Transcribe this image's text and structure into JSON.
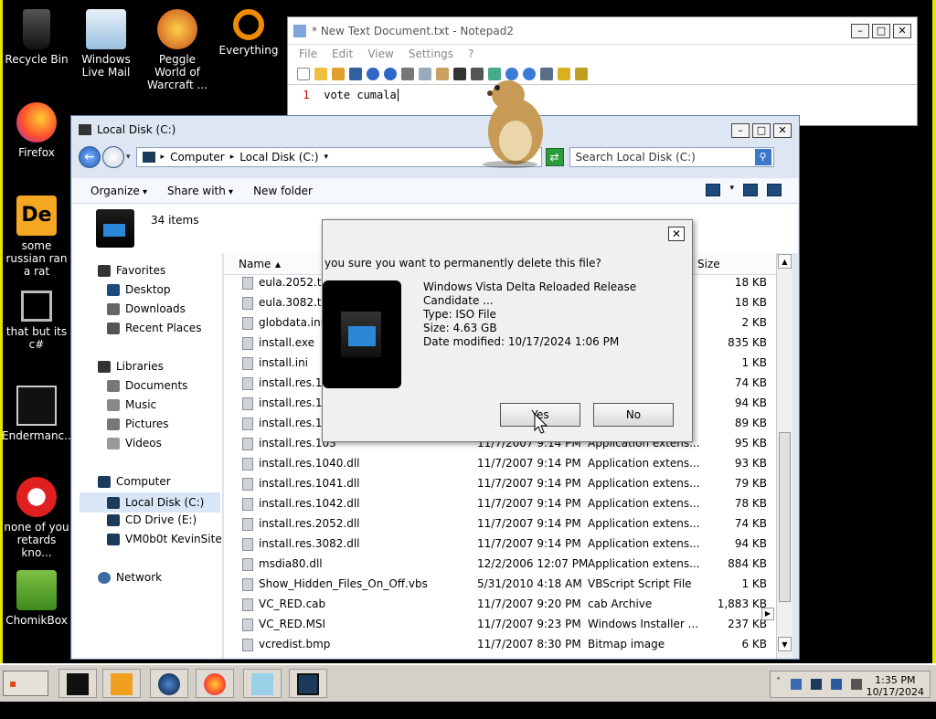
{
  "desktop": {
    "icons": [
      {
        "label": "Recycle Bin",
        "icon": "recycle-bin-icon"
      },
      {
        "label": "Windows Live Mail",
        "icon": "mail-icon"
      },
      {
        "label": "Peggle World of Warcraft ...",
        "icon": "peggle-icon"
      },
      {
        "label": "Everything",
        "icon": "magnifier-icon"
      },
      {
        "label": "Firefox",
        "icon": "firefox-icon"
      },
      {
        "label": "some russian ran a rat",
        "icon": "de-icon"
      },
      {
        "label": "that but its c#",
        "icon": "windows-stack-icon"
      },
      {
        "label": "Endermanc...",
        "icon": "terminal-icon"
      },
      {
        "label": "none of you retards kno...",
        "icon": "dragon-icon"
      },
      {
        "label": "ChomikBox",
        "icon": "hamster-box-icon"
      }
    ]
  },
  "notepad": {
    "title": "* New Text Document.txt - Notepad2",
    "menu": [
      "File",
      "Edit",
      "View",
      "Settings",
      "?"
    ],
    "line_number": "1",
    "content": "vote cumala"
  },
  "explorer": {
    "title": "Local Disk (C:)",
    "breadcrumb": [
      "Computer",
      "Local Disk (C:)"
    ],
    "search_placeholder": "Search Local Disk (C:)",
    "commands": {
      "organize": "Organize",
      "share": "Share with",
      "new_folder": "New folder"
    },
    "item_count": "34 items",
    "nav": {
      "favorites": "Favorites",
      "desktop": "Desktop",
      "downloads": "Downloads",
      "recent": "Recent Places",
      "libraries": "Libraries",
      "documents": "Documents",
      "music": "Music",
      "pictures": "Pictures",
      "videos": "Videos",
      "computer": "Computer",
      "local_disk": "Local Disk (C:)",
      "cd_drive": "CD Drive (E:)",
      "vm": "VM0b0t KevinSite",
      "network": "Network"
    },
    "columns": {
      "name": "Name",
      "size": "Size"
    },
    "files": [
      {
        "name": "eula.2052.txt",
        "date": "",
        "type": "",
        "size": "18 KB"
      },
      {
        "name": "eula.3082.txt",
        "date": "",
        "type": "",
        "size": "18 KB"
      },
      {
        "name": "globdata.ini",
        "date": "",
        "type": "",
        "size": "2 KB"
      },
      {
        "name": "install.exe",
        "date": "",
        "type": "",
        "size": "835 KB"
      },
      {
        "name": "install.ini",
        "date": "",
        "type": "",
        "size": "1 KB"
      },
      {
        "name": "install.res.102",
        "date": "",
        "type": "",
        "size": "74 KB"
      },
      {
        "name": "install.res.103",
        "date": "",
        "type": "",
        "size": "94 KB"
      },
      {
        "name": "install.res.103",
        "date": "",
        "type": "",
        "size": "89 KB"
      },
      {
        "name": "install.res.103",
        "date": "11/7/2007 9:14 PM",
        "type": "Application extens...",
        "size": "95 KB"
      },
      {
        "name": "install.res.1040.dll",
        "date": "11/7/2007 9:14 PM",
        "type": "Application extens...",
        "size": "93 KB"
      },
      {
        "name": "install.res.1041.dll",
        "date": "11/7/2007 9:14 PM",
        "type": "Application extens...",
        "size": "79 KB"
      },
      {
        "name": "install.res.1042.dll",
        "date": "11/7/2007 9:14 PM",
        "type": "Application extens...",
        "size": "78 KB"
      },
      {
        "name": "install.res.2052.dll",
        "date": "11/7/2007 9:14 PM",
        "type": "Application extens...",
        "size": "74 KB"
      },
      {
        "name": "install.res.3082.dll",
        "date": "11/7/2007 9:14 PM",
        "type": "Application extens...",
        "size": "94 KB"
      },
      {
        "name": "msdia80.dll",
        "date": "12/2/2006 12:07 PM",
        "type": "Application extens...",
        "size": "884 KB"
      },
      {
        "name": "Show_Hidden_Files_On_Off.vbs",
        "date": "5/31/2010 4:18 AM",
        "type": "VBScript Script File",
        "size": "1 KB"
      },
      {
        "name": "VC_RED.cab",
        "date": "11/7/2007 9:20 PM",
        "type": "cab Archive",
        "size": "1,883 KB"
      },
      {
        "name": "VC_RED.MSI",
        "date": "11/7/2007 9:23 PM",
        "type": "Windows Installer ...",
        "size": "237 KB"
      },
      {
        "name": "vcredist.bmp",
        "date": "11/7/2007 8:30 PM",
        "type": "Bitmap image",
        "size": "6 KB"
      }
    ]
  },
  "dialog": {
    "question": "you sure you want to permanently delete this file?",
    "file_name": "Windows Vista Delta Reloaded Release Candidate ...",
    "type": "Type: ISO File",
    "size": "Size: 4.63 GB",
    "date": "Date modified: 10/17/2024 1:06 PM",
    "yes": "Yes",
    "no": "No"
  },
  "taskbar": {
    "start": "Start",
    "time": "1:35 PM",
    "date": "10/17/2024"
  },
  "colors": {
    "accent": "#1b58b8",
    "frame": "#e6e600"
  }
}
